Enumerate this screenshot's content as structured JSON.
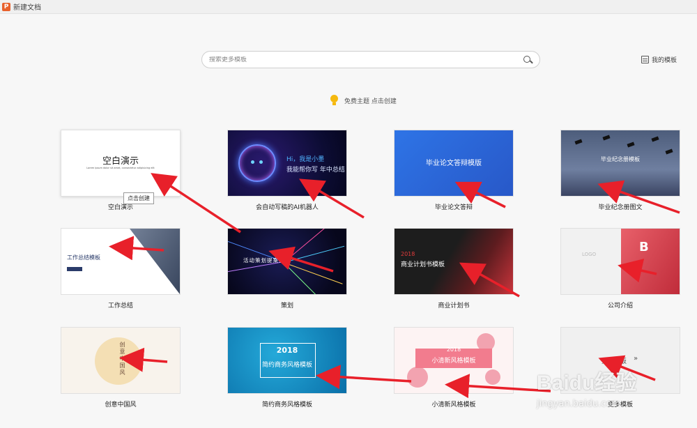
{
  "window": {
    "title": "新建文档"
  },
  "search": {
    "placeholder": "搜索更多模板"
  },
  "my_templates": {
    "label": "我的模板"
  },
  "free_theme": {
    "label": "免费主题 点击创建"
  },
  "tooltip": "点击创建",
  "cards": [
    {
      "label": "空白演示",
      "thumb_title": "空白演示",
      "thumb_sub": "Lorem ipsum dolor sit amet, consectetur adipisicing elit"
    },
    {
      "label": "会自动写稿的AI机器人",
      "thumb_line1": "Hi，我是小墨",
      "thumb_line2": "我能帮你写 年中总结"
    },
    {
      "label": "毕业论文答辩",
      "thumb_title": "毕业论文答辩模版"
    },
    {
      "label": "毕业纪念册图文",
      "thumb_title": "毕业纪念册模板"
    },
    {
      "label": "工作总结",
      "thumb_title": "工作总结模板"
    },
    {
      "label": "策划",
      "thumb_title": "活动策划提案模板"
    },
    {
      "label": "商业计划书",
      "thumb_year": "2018",
      "thumb_title": "商业计划书模板"
    },
    {
      "label": "公司介绍",
      "thumb_logo": "LOGO",
      "thumb_letter": "B"
    },
    {
      "label": "创意中国风",
      "thumb_title": "创意中国风"
    },
    {
      "label": "简约商务风格模板",
      "thumb_year": "2018",
      "thumb_title": "简约商务风格模板"
    },
    {
      "label": "小清新风格模板",
      "thumb_year": "2018",
      "thumb_title": "小清新风格模板"
    },
    {
      "label": "更多模板",
      "thumb_title": "更多模板",
      "thumb_chevron": "»"
    }
  ],
  "watermark": {
    "logo": "Baidu经验",
    "url": "jingyan.baidu.com"
  },
  "colors": {
    "arrow": "#e8202a",
    "accent": "#e8612c"
  },
  "icons": [
    "app-icon",
    "search-icon",
    "doc-icon",
    "bulb-icon"
  ]
}
